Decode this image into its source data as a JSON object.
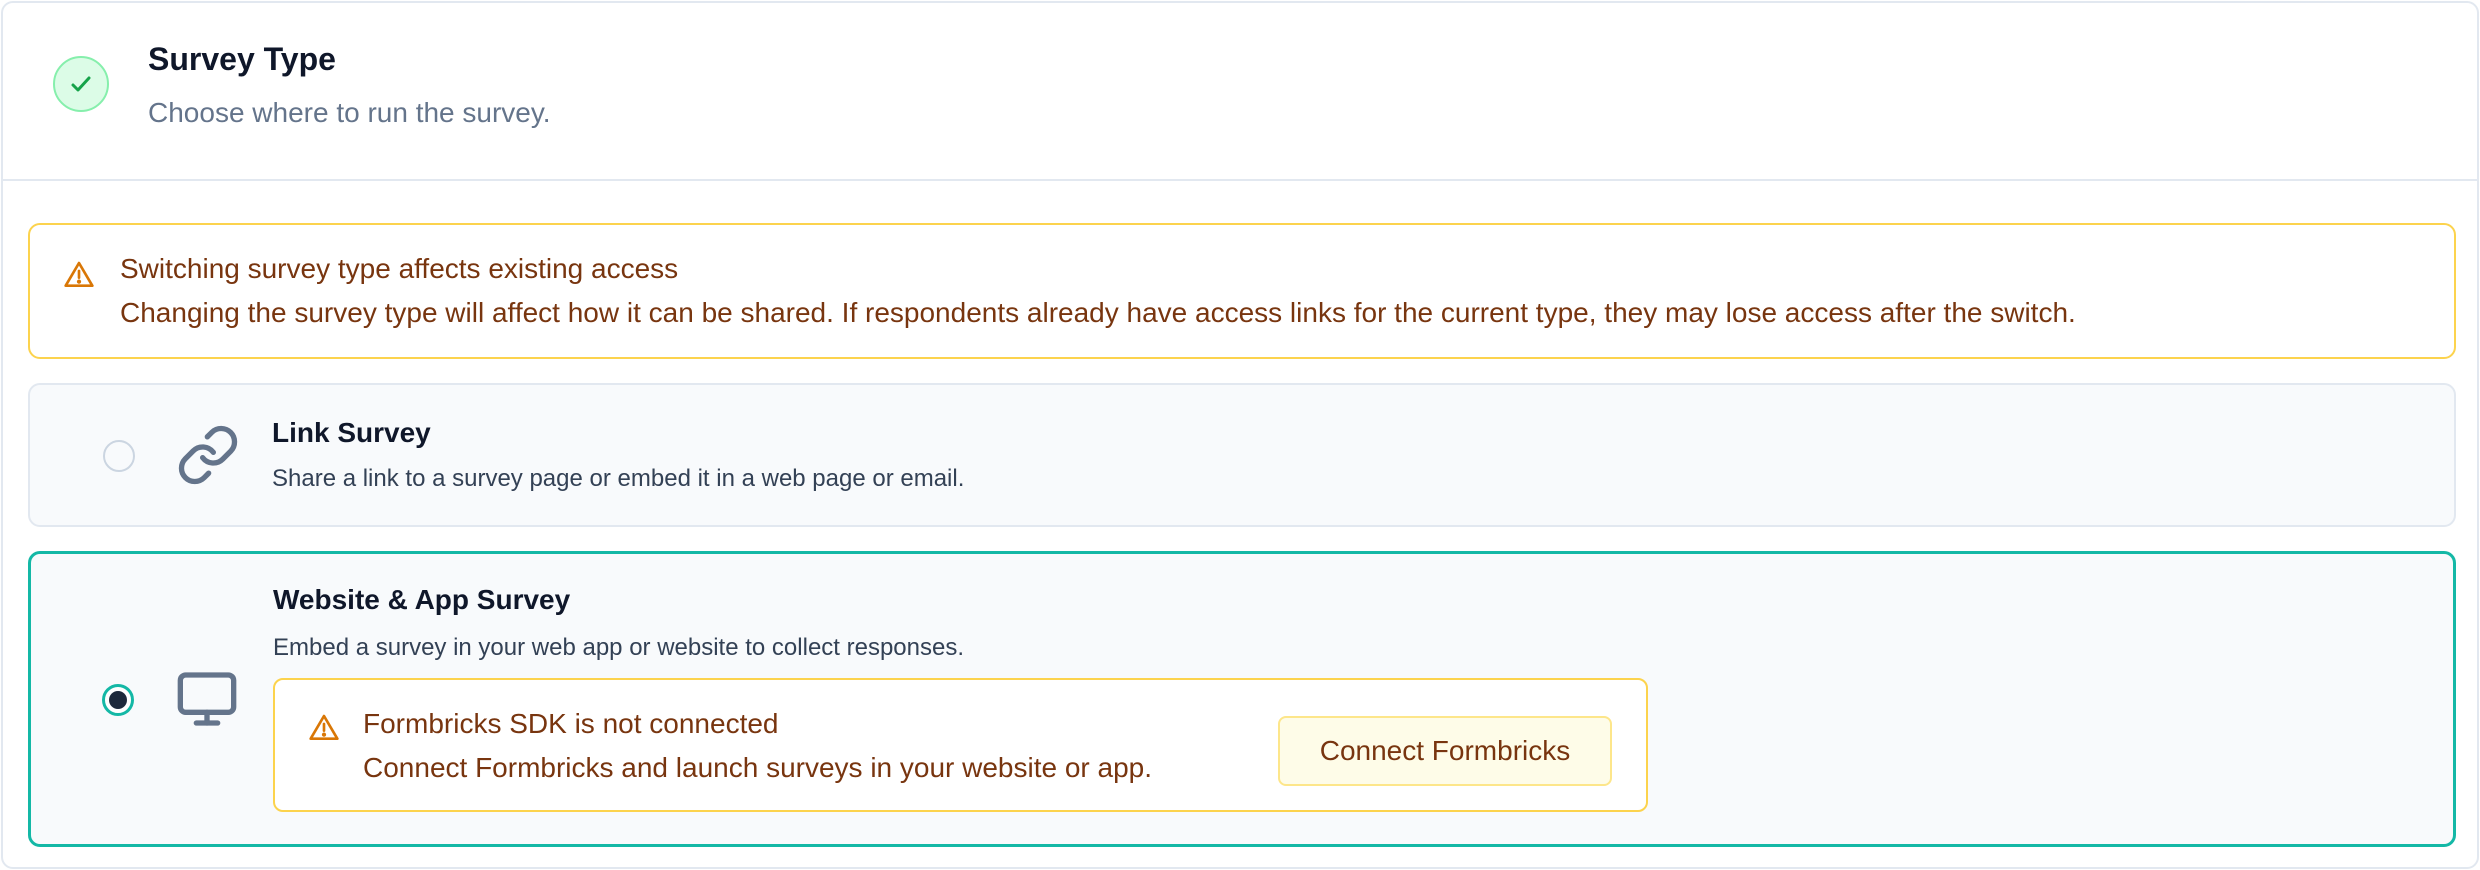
{
  "header": {
    "title": "Survey Type",
    "subtitle": "Choose where to run the survey."
  },
  "warning": {
    "title": "Switching survey type affects existing access",
    "description": "Changing the survey type will affect how it can be shared. If respondents already have access links for the current type, they may lose access after the switch."
  },
  "options": [
    {
      "title": "Link Survey",
      "description": "Share a link to a survey page or embed it in a web page or email.",
      "icon": "link-icon",
      "selected": false
    },
    {
      "title": "Website & App Survey",
      "description": "Embed a survey in your web app or website to collect responses.",
      "icon": "monitor-icon",
      "selected": true
    }
  ],
  "sdk_alert": {
    "title": "Formbricks SDK is not connected",
    "description": "Connect Formbricks and launch surveys in your website or app.",
    "button_label": "Connect Formbricks"
  },
  "colors": {
    "accent": "#14b8a6",
    "warning_border": "#fcd34d",
    "warning_text": "#78350f",
    "success": "#16a34a"
  }
}
